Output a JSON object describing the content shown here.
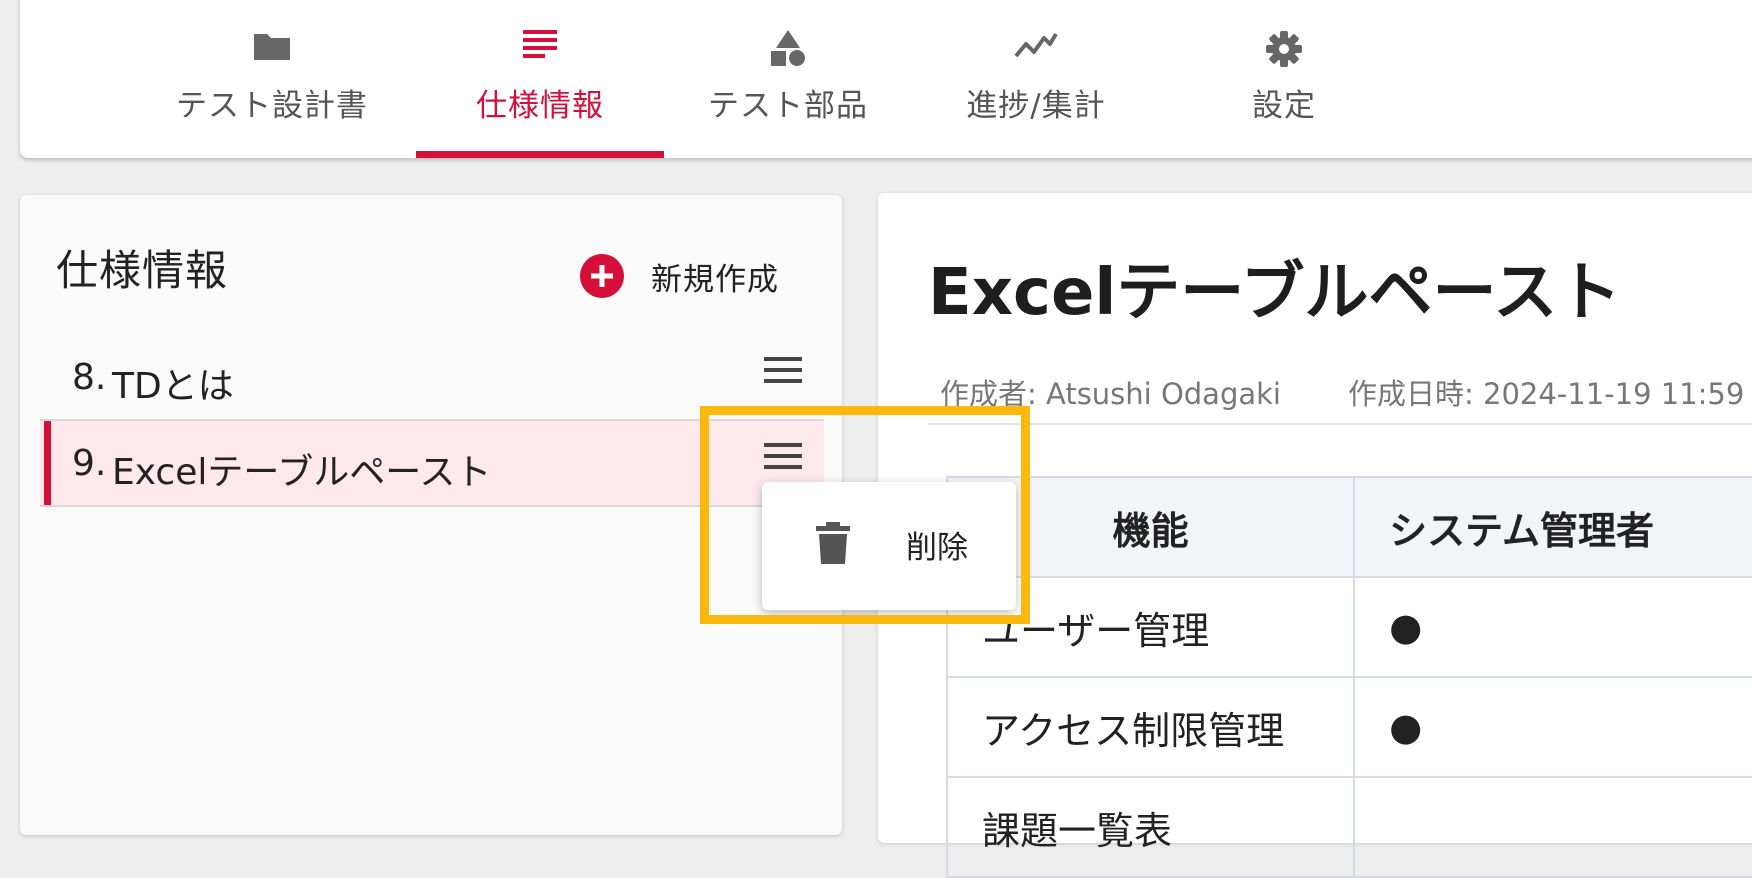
{
  "nav": {
    "tabs": [
      {
        "label": "テスト設計書",
        "icon": "folder-icon"
      },
      {
        "label": "仕様情報",
        "icon": "list-icon",
        "active": true
      },
      {
        "label": "テスト部品",
        "icon": "shapes-icon"
      },
      {
        "label": "進捗/集計",
        "icon": "trend-chart-icon"
      },
      {
        "label": "設定",
        "icon": "gear-icon"
      }
    ]
  },
  "sidebar": {
    "title": "仕様情報",
    "new_button_label": "新規作成",
    "items": [
      {
        "number": "8.",
        "title": "TDとは",
        "selected": false
      },
      {
        "number": "9.",
        "title": "Excelテーブルペースト",
        "selected": true
      }
    ]
  },
  "context_menu": {
    "delete_label": "削除"
  },
  "document": {
    "title": "Excelテーブルペースト",
    "author": "作成者: Atsushi Odagaki",
    "created": "作成日時: 2024-11-19 11:59",
    "table": {
      "headers": [
        "機能",
        "システム管理者"
      ],
      "rows": [
        [
          "ユーザー管理",
          "●"
        ],
        [
          "アクセス制限管理",
          "●"
        ],
        [
          "課題一覧表",
          ""
        ]
      ]
    }
  },
  "colors": {
    "accent": "#d4103a",
    "highlight": "#fbb90e",
    "selected_row_bg": "#fde8ec"
  }
}
